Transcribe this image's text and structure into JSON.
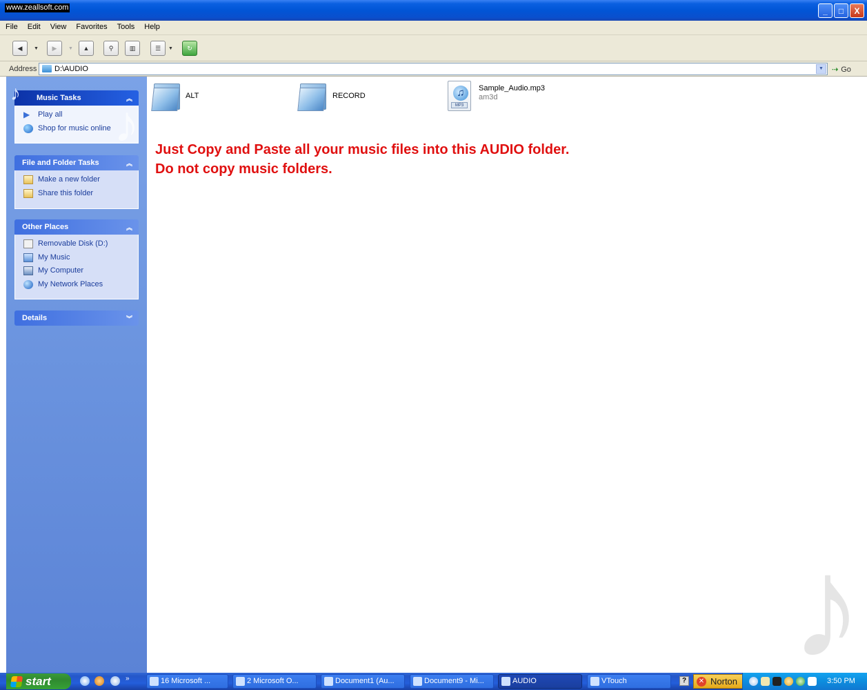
{
  "window": {
    "watermark": "www.zeallsoft.com",
    "controls": {
      "minimize": "_",
      "maximize": "□",
      "close": "X"
    }
  },
  "menu": [
    "File",
    "Edit",
    "View",
    "Favorites",
    "Tools",
    "Help"
  ],
  "toolbar": {
    "back_icon": "back-arrow-icon",
    "forward_icon": "forward-arrow-icon",
    "up_icon": "up-folder-icon",
    "search_icon": "search-icon",
    "folders_icon": "folders-icon",
    "views_icon": "views-icon",
    "sync_icon": "sync-icon"
  },
  "address": {
    "label": "Address",
    "value": "D:\\AUDIO",
    "go_label": "Go"
  },
  "sidebar": {
    "music_tasks": {
      "title": "Music Tasks",
      "items": [
        "Play all",
        "Shop for music online"
      ]
    },
    "file_folder_tasks": {
      "title": "File and Folder Tasks",
      "items": [
        "Make a new folder",
        "Share this folder"
      ]
    },
    "other_places": {
      "title": "Other Places",
      "items": [
        "Removable Disk (D:)",
        "My Music",
        "My Computer",
        "My Network Places"
      ]
    },
    "details": {
      "title": "Details"
    }
  },
  "files": [
    {
      "name": "ALT",
      "kind": "folder"
    },
    {
      "name": "RECORD",
      "kind": "folder"
    },
    {
      "name": "Sample_Audio.mp3",
      "type": "am3d",
      "badge": "MP3",
      "kind": "mp3"
    }
  ],
  "notice": {
    "line1": "Just Copy and Paste all your music files into this AUDIO folder.",
    "line2": "Do not copy music folders."
  },
  "taskbar": {
    "start": "start",
    "tasks": [
      "16 Microsoft ...",
      "2 Microsoft O...",
      "Document1 (Au...",
      "Document9 - Mi...",
      "AUDIO",
      "VTouch"
    ],
    "norton": "Norton",
    "clock": "3:50 PM"
  },
  "colors": {
    "titlebar": "#0155d6",
    "notice": "#e01010",
    "pane": "#6d96e0",
    "start": "#2f8a2f"
  }
}
